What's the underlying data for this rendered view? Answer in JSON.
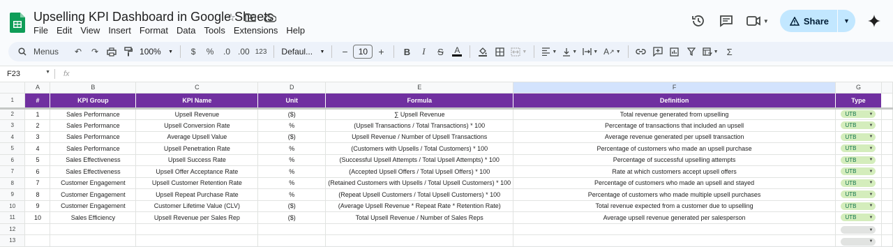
{
  "doc": {
    "title": "Upselling KPI Dashboard in Google Sheets"
  },
  "menu": [
    "File",
    "Edit",
    "View",
    "Insert",
    "Format",
    "Data",
    "Tools",
    "Extensions",
    "Help"
  ],
  "header_actions": {
    "share_label": "Share"
  },
  "toolbar": {
    "menus_label": "Menus",
    "zoom": "100%",
    "currency": "$",
    "percent": "%",
    "dec_decrease": ".0",
    "dec_increase": ".00",
    "number_format": "123",
    "font": "Defaul...",
    "font_size": "10",
    "minus": "−",
    "plus": "+"
  },
  "formula_bar": {
    "cell_ref": "F23",
    "fx": "fx"
  },
  "columns": [
    "A",
    "B",
    "C",
    "D",
    "E",
    "F",
    "G"
  ],
  "header": [
    "#",
    "KPI Group",
    "KPI Name",
    "Unit",
    "Formula",
    "Definition",
    "Type"
  ],
  "rows": [
    [
      "1",
      "Sales Performance",
      "Upsell Revenue",
      "($)",
      "∑ Upsell Revenue",
      "Total revenue generated from upselling",
      "UTB"
    ],
    [
      "2",
      "Sales Performance",
      "Upsell Conversion Rate",
      "%",
      "(Upsell Transactions / Total Transactions) * 100",
      "Percentage of transactions that included an upsell",
      "UTB"
    ],
    [
      "3",
      "Sales Performance",
      "Average Upsell Value",
      "($)",
      "Upsell Revenue / Number of Upsell Transactions",
      "Average revenue generated per upsell transaction",
      "UTB"
    ],
    [
      "4",
      "Sales Performance",
      "Upsell Penetration Rate",
      "%",
      "(Customers with Upsells / Total Customers) * 100",
      "Percentage of customers who made an upsell purchase",
      "UTB"
    ],
    [
      "5",
      "Sales Effectiveness",
      "Upsell Success Rate",
      "%",
      "(Successful Upsell Attempts / Total Upsell Attempts) * 100",
      "Percentage of successful upselling attempts",
      "UTB"
    ],
    [
      "6",
      "Sales Effectiveness",
      "Upsell Offer Acceptance Rate",
      "%",
      "(Accepted Upsell Offers / Total Upsell Offers) * 100",
      "Rate at which customers accept upsell offers",
      "UTB"
    ],
    [
      "7",
      "Customer Engagement",
      "Upsell Customer Retention Rate",
      "%",
      "(Retained Customers with Upsells / Total Upsell Customers) * 100",
      "Percentage of customers who made an upsell and stayed",
      "UTB"
    ],
    [
      "8",
      "Customer Engagement",
      "Upsell Repeat Purchase Rate",
      "%",
      "(Repeat Upsell Customers / Total Upsell Customers) * 100",
      "Percentage of customers who made multiple upsell purchases",
      "UTB"
    ],
    [
      "9",
      "Customer Engagement",
      "Customer Lifetime Value (CLV)",
      "($)",
      "(Average Upsell Revenue * Repeat Rate * Retention Rate)",
      "Total revenue expected from a customer due to upselling",
      "UTB"
    ],
    [
      "10",
      "Sales Efficiency",
      "Upsell Revenue per Sales Rep",
      "($)",
      "Total Upsell Revenue / Number of Sales Reps",
      "Average upsell revenue generated per salesperson",
      "UTB"
    ]
  ],
  "row_numbers": [
    "1",
    "2",
    "3",
    "4",
    "5",
    "6",
    "7",
    "8",
    "9",
    "10",
    "11",
    "12",
    "13"
  ],
  "colors": {
    "header_bg": "#7030a0",
    "chip_bg": "#d4edbc",
    "share_bg": "#c2e7ff"
  }
}
